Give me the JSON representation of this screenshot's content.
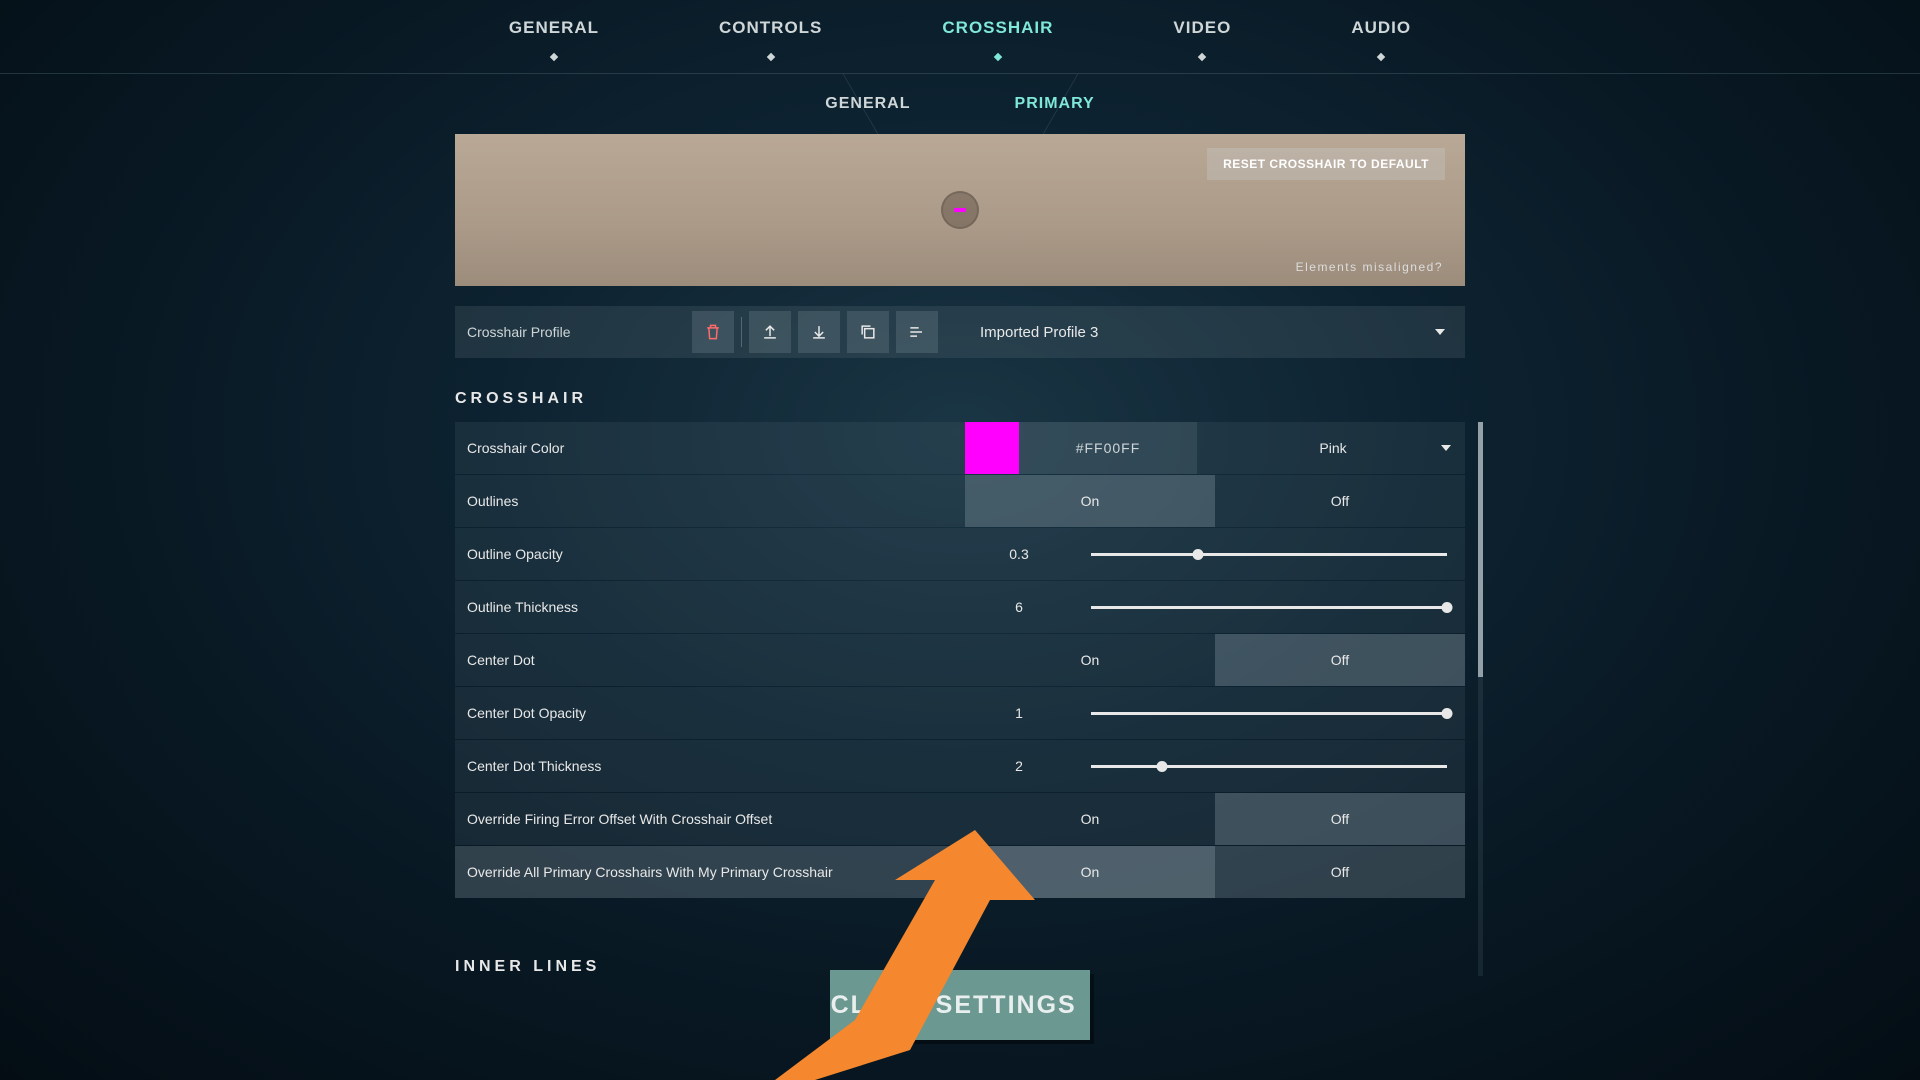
{
  "topnav": {
    "items": [
      "GENERAL",
      "CONTROLS",
      "CROSSHAIR",
      "VIDEO",
      "AUDIO"
    ],
    "active": 2
  },
  "subnav": {
    "items": [
      "GENERAL",
      "PRIMARY"
    ],
    "active": 1
  },
  "preview": {
    "reset_label": "RESET CROSSHAIR TO DEFAULT",
    "misaligned_label": "Elements misaligned?"
  },
  "profile": {
    "label": "Crosshair Profile",
    "selected": "Imported Profile 3"
  },
  "section_crosshair": "CROSSHAIR",
  "section_inner": "INNER LINES",
  "toggles": {
    "on": "On",
    "off": "Off"
  },
  "rows": {
    "color": {
      "label": "Crosshair Color",
      "hex": "#FF00FF",
      "swatch": "#ff00ff",
      "name": "Pink"
    },
    "outlines": {
      "label": "Outlines",
      "value": "on"
    },
    "outline_opacity": {
      "label": "Outline Opacity",
      "value": "0.3",
      "pct": 30
    },
    "outline_thickness": {
      "label": "Outline Thickness",
      "value": "6",
      "pct": 100
    },
    "center_dot": {
      "label": "Center Dot",
      "value": "off"
    },
    "center_dot_opacity": {
      "label": "Center Dot Opacity",
      "value": "1",
      "pct": 100
    },
    "center_dot_thickness": {
      "label": "Center Dot Thickness",
      "value": "2",
      "pct": 20
    },
    "override_firing": {
      "label": "Override Firing Error Offset With Crosshair Offset",
      "value": "off"
    },
    "override_primary": {
      "label": "Override All Primary Crosshairs With My Primary Crosshair",
      "value": "on"
    }
  },
  "close_label": "CLOSE SETTINGS"
}
